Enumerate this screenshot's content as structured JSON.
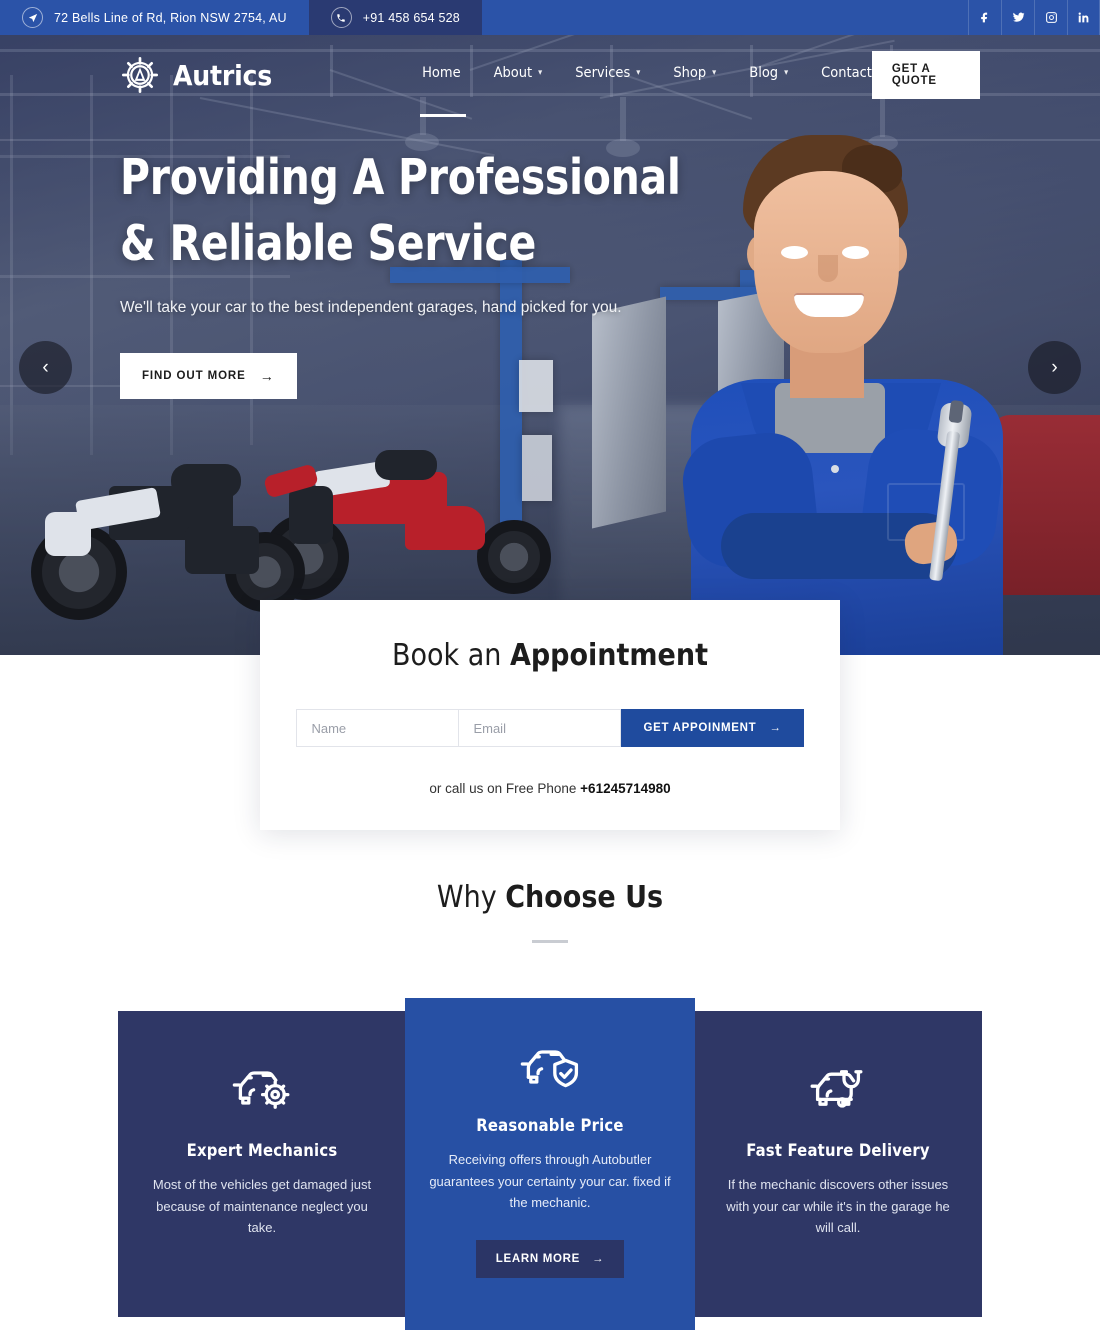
{
  "topbar": {
    "address": "72 Bells Line of Rd, Rion NSW 2754, AU",
    "phone": "+91 458 654 528",
    "address_icon": "location-arrow-icon",
    "phone_icon": "phone-icon",
    "social": [
      {
        "name": "facebook",
        "label": "f"
      },
      {
        "name": "twitter",
        "label": "t"
      },
      {
        "name": "instagram",
        "label": "ig"
      },
      {
        "name": "linkedin",
        "label": "in"
      }
    ],
    "bg_color": "#2b53a8",
    "phone_bg_color": "#2a3a72"
  },
  "header": {
    "brand": "Autrics",
    "logo_icon": "gear-circle-a-logo",
    "nav": [
      {
        "label": "Home",
        "has_dropdown": false,
        "active": true
      },
      {
        "label": "About",
        "has_dropdown": true,
        "active": false
      },
      {
        "label": "Services",
        "has_dropdown": true,
        "active": false
      },
      {
        "label": "Shop",
        "has_dropdown": true,
        "active": false
      },
      {
        "label": "Blog",
        "has_dropdown": true,
        "active": false
      },
      {
        "label": "Contact",
        "has_dropdown": false,
        "active": false
      }
    ],
    "quote_button": "GET A QUOTE"
  },
  "hero": {
    "heading_line1": "Providing A Professional",
    "heading_line2": "& Reliable Service",
    "subheading": "We'll take your car to the best independent garages, hand picked for you.",
    "cta_label": "FIND OUT MORE",
    "cta_arrow": "→",
    "prev_arrow": "‹",
    "next_arrow": "›"
  },
  "appointment": {
    "title_light": "Book an ",
    "title_bold": "Appointment",
    "name_placeholder": "Name",
    "name_value": "",
    "email_placeholder": "Email",
    "email_value": "",
    "submit_label": "GET APPOINMENT",
    "submit_arrow": "→",
    "call_prefix": "or call us on Free Phone ",
    "call_number": "+61245714980",
    "accent_color": "#1f4b9e"
  },
  "why": {
    "title_light": "Why ",
    "title_bold": "Choose Us"
  },
  "features": {
    "cards": [
      {
        "icon": "car-gear-icon",
        "title": "Expert Mechanics",
        "text": "Most of the vehicles get damaged just because of maintenance neglect you take.",
        "bg_color": "#2f3766",
        "highlighted": false,
        "button": null
      },
      {
        "icon": "car-shield-check-icon",
        "title": "Reasonable Price",
        "text": "Receiving offers through Autobutler guarantees your certainty your car. fixed if the mechanic.",
        "bg_color": "#2750a4",
        "highlighted": true,
        "button": "LEARN MORE",
        "button_arrow": "→"
      },
      {
        "icon": "car-stethoscope-icon",
        "title": "Fast Feature Delivery",
        "text": "If the mechanic discovers other issues with your car while it's in the garage he will call.",
        "bg_color": "#2f3766",
        "highlighted": false,
        "button": null
      }
    ]
  }
}
